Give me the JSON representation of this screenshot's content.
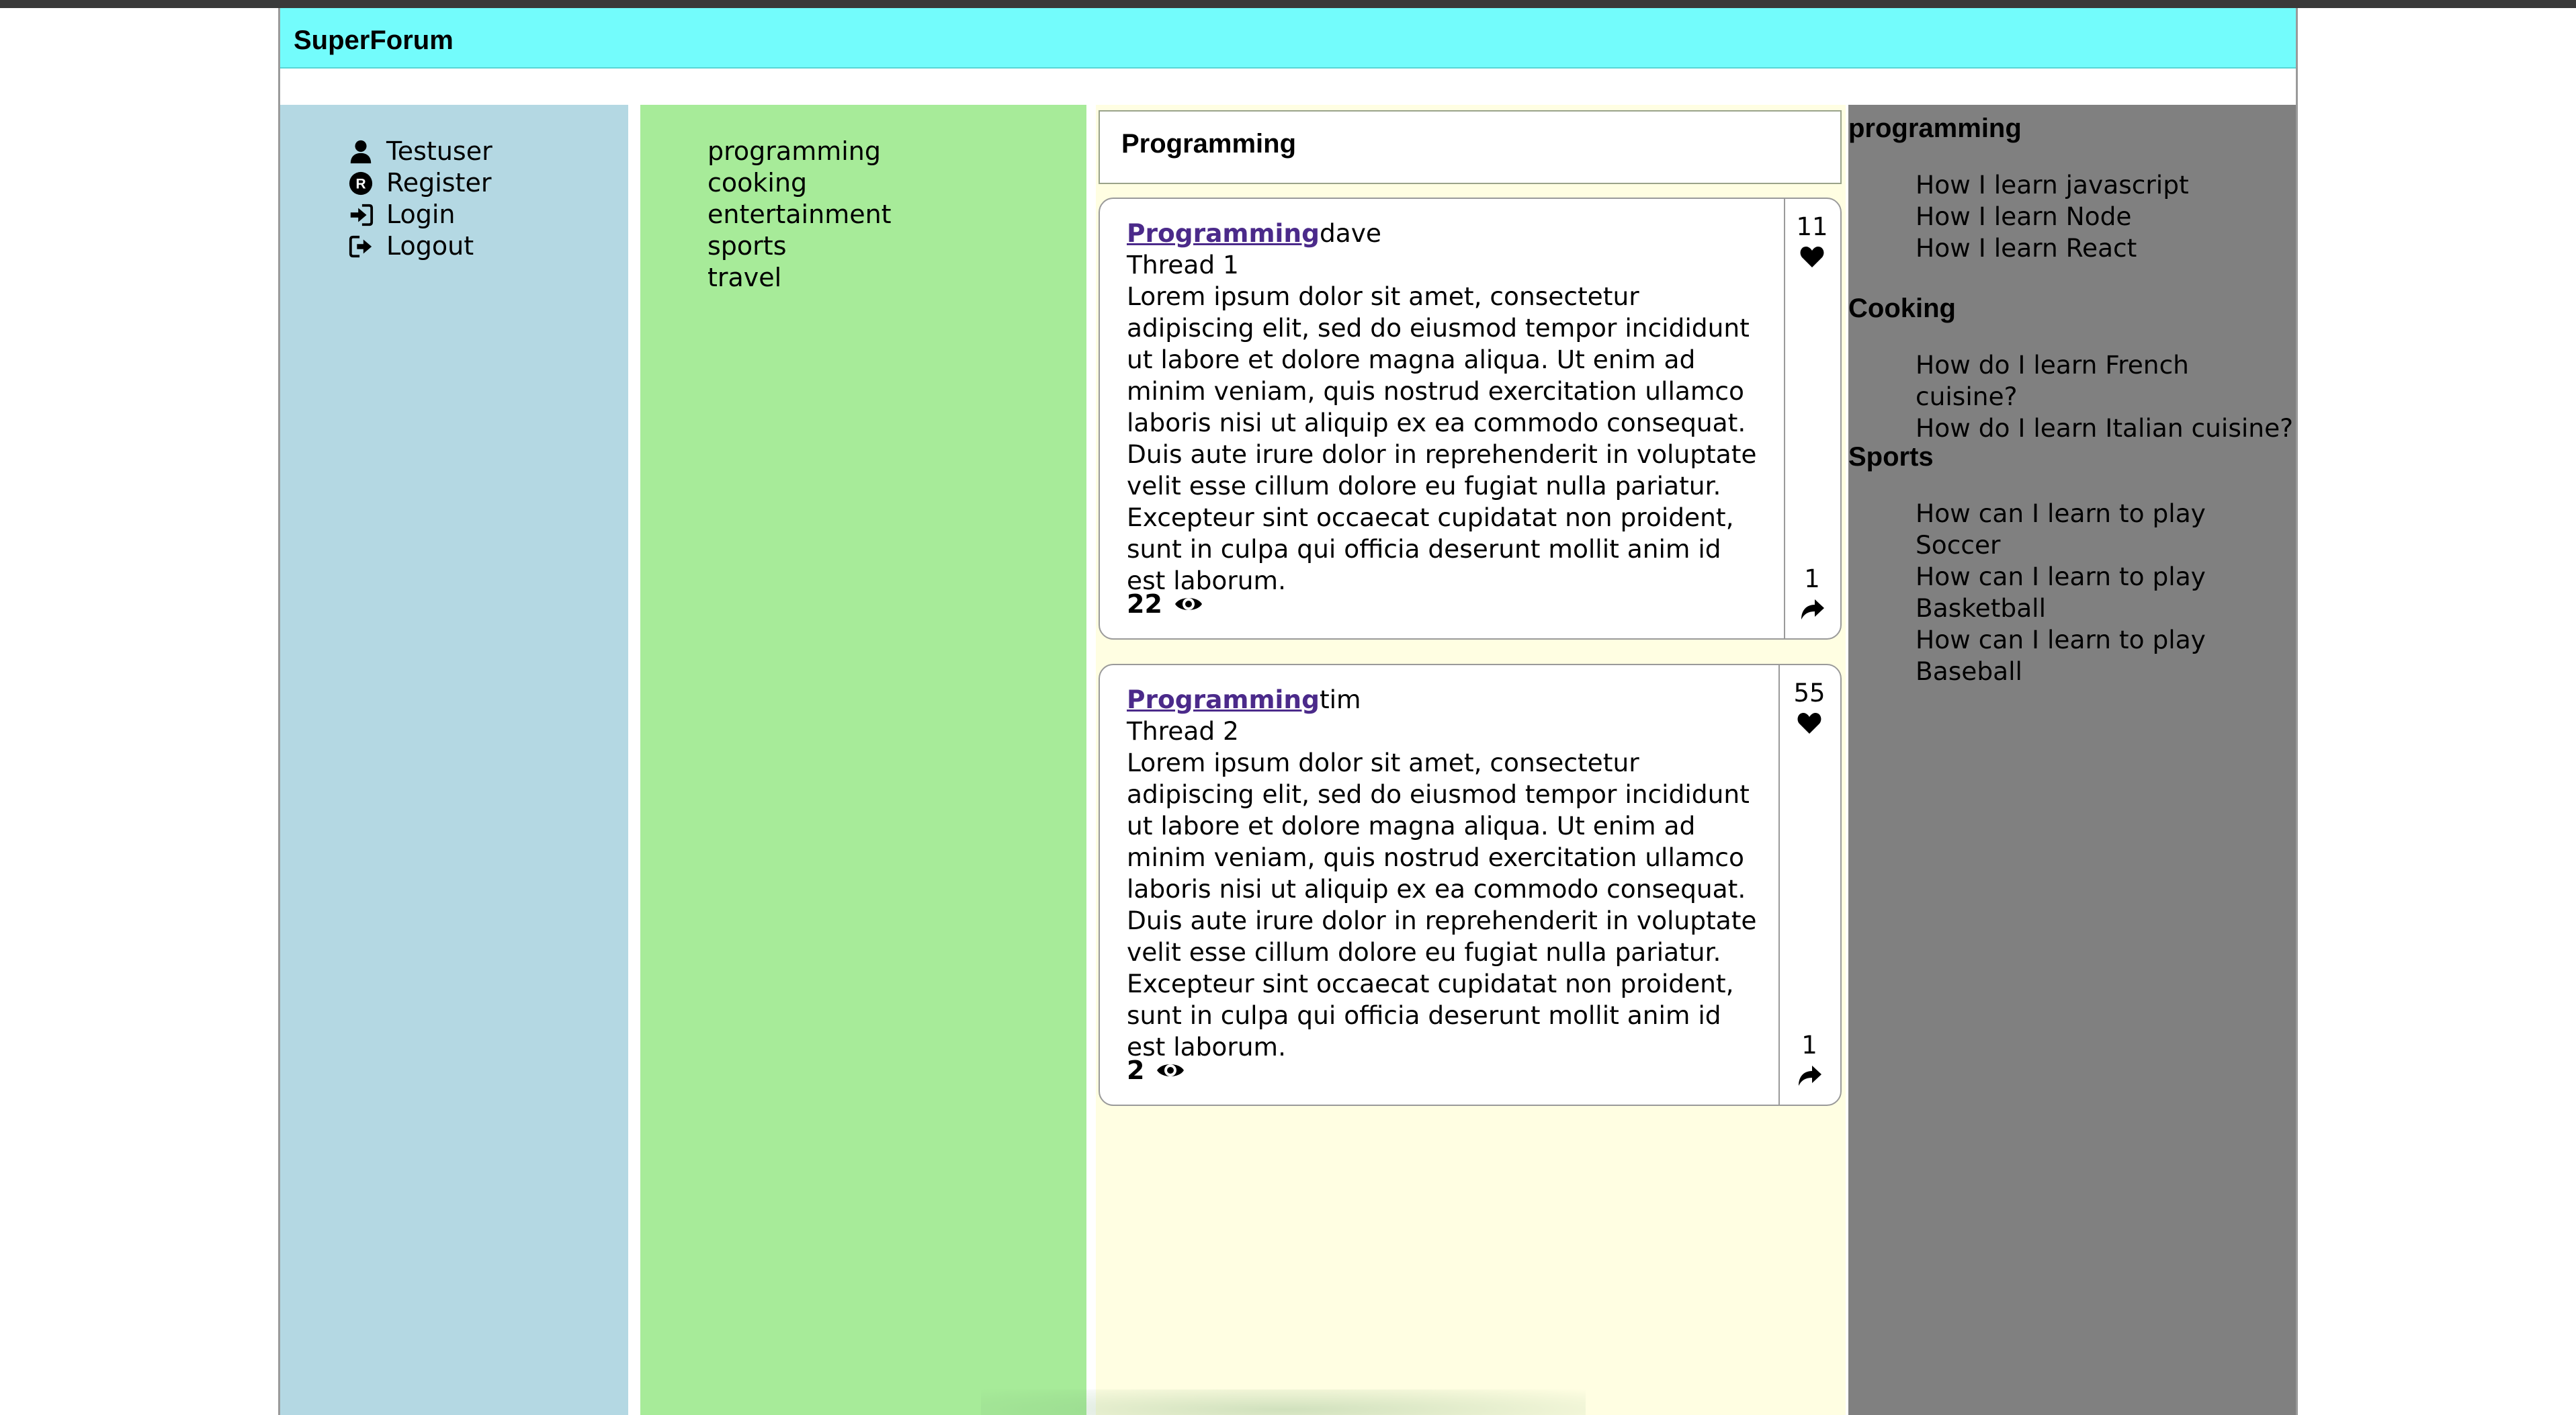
{
  "app": {
    "title": "SuperForum"
  },
  "left_nav": {
    "items": [
      {
        "label": "Testuser",
        "icon": "user-icon"
      },
      {
        "label": "Register",
        "icon": "register-icon"
      },
      {
        "label": "Login",
        "icon": "login-icon"
      },
      {
        "label": "Logout",
        "icon": "logout-icon"
      }
    ]
  },
  "categories": [
    "programming",
    "cooking",
    "entertainment",
    "sports",
    "travel"
  ],
  "main": {
    "category_title": "Programming",
    "threads": [
      {
        "category_link": "Programming",
        "author": "dave",
        "title": "Thread 1",
        "body": "Lorem ipsum dolor sit amet, consectetur adipiscing elit, sed do eiusmod tempor incididunt ut labore et dolore magna aliqua. Ut enim ad minim veniam, quis nostrud exercitation ullamco laboris nisi ut aliquip ex ea commodo consequat. Duis aute irure dolor in reprehenderit in voluptate velit esse cillum dolore eu fugiat nulla pariatur. Excepteur sint occaecat cupidatat non proident, sunt in culpa qui officia deserunt mollit anim id est laborum.",
        "views": "22",
        "likes": "11",
        "responses": "1"
      },
      {
        "category_link": "Programming",
        "author": "tim",
        "title": "Thread 2",
        "body": "Lorem ipsum dolor sit amet, consectetur adipiscing elit, sed do eiusmod tempor incididunt ut labore et dolore magna aliqua. Ut enim ad minim veniam, quis nostrud exercitation ullamco laboris nisi ut aliquip ex ea commodo consequat. Duis aute irure dolor in reprehenderit in voluptate velit esse cillum dolore eu fugiat nulla pariatur. Excepteur sint occaecat cupidatat non proident, sunt in culpa qui officia deserunt mollit anim id est laborum.",
        "views": "2",
        "likes": "55",
        "responses": "1"
      }
    ]
  },
  "right_sidebar": {
    "sections": [
      {
        "title": "programming",
        "items": [
          "How I learn javascript",
          "How I learn Node",
          "How I learn React"
        ]
      },
      {
        "title": "Cooking",
        "items": [
          "How do I learn French cuisine?",
          "How do I learn Italian cuisine?"
        ]
      },
      {
        "title": "Sports",
        "items": [
          "How can I learn to play Soccer",
          "How can I learn to play Basketball",
          "How can I learn to play Baseball"
        ]
      }
    ]
  },
  "colors": {
    "header": "#73fcfc",
    "left_nav_bg": "#b4d8e3",
    "categories_bg": "#a7eb99",
    "main_bg": "#fffee2",
    "right_sidebar_bg": "#808080",
    "link": "#4b2a8a"
  }
}
